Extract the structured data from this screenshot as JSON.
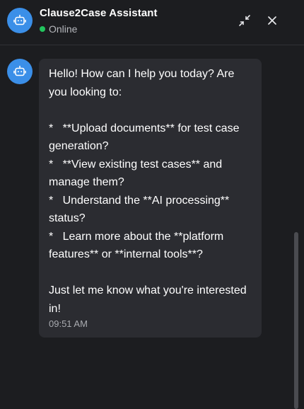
{
  "header": {
    "title": "Clause2Case Assistant",
    "status": "Online",
    "avatar_icon": "robot-icon",
    "minimize_icon": "minimize-icon",
    "close_icon": "close-icon",
    "status_color": "#22c55e"
  },
  "messages": [
    {
      "sender_icon": "robot-icon",
      "text": "Hello! How can I help you today? Are you looking to:\n\n*   **Upload documents** for test case generation?\n*   **View existing test cases** and manage them?\n*   Understand the **AI processing** status?\n*   Learn more about the **platform features** or **internal tools**?\n\nJust let me know what you're interested in!",
      "time": "09:51 AM"
    }
  ],
  "colors": {
    "background": "#1c1d20",
    "bubble": "#2b2c31",
    "accent": "#3b8fe8"
  }
}
